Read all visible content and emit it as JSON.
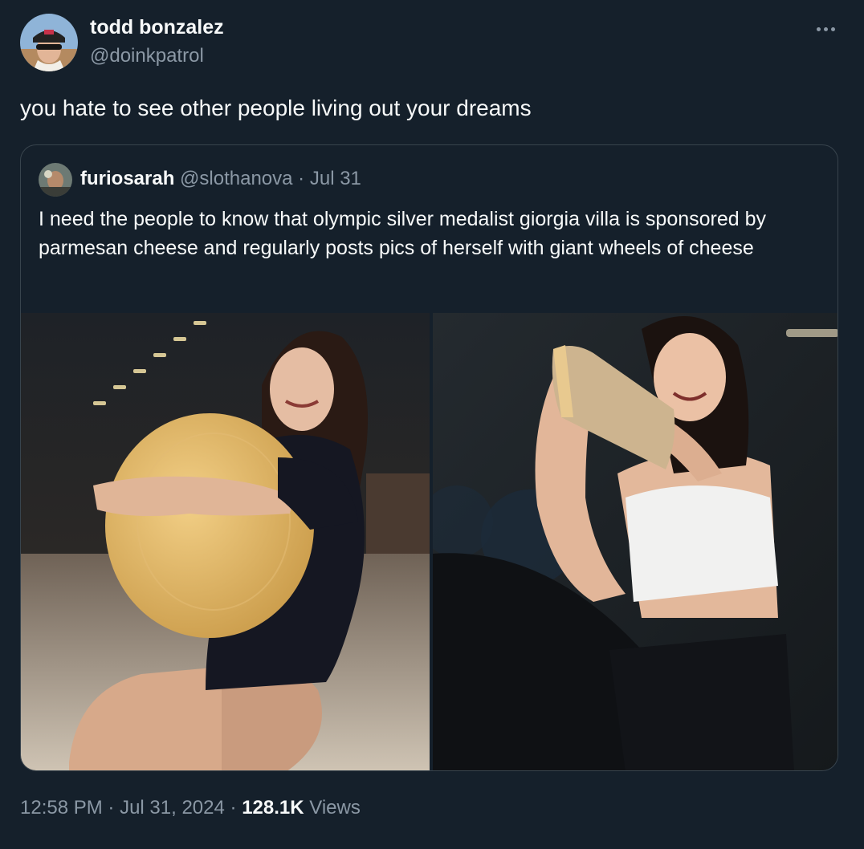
{
  "tweet": {
    "author": {
      "name": "todd bonzalez",
      "handle": "@doinkpatrol"
    },
    "text": "you hate to see other people living out your dreams",
    "more_icon": "more-horizontal-icon"
  },
  "quoted_tweet": {
    "author": {
      "name": "furiosarah",
      "handle": "@slothanova"
    },
    "separator": "·",
    "date": "Jul 31",
    "text": "I need the people to know that olympic silver medalist giorgia villa is sponsored by parmesan cheese and regularly posts pics of herself with giant wheels of cheese",
    "media_count": 2
  },
  "meta": {
    "time": "12:58 PM",
    "sep1": "·",
    "date": "Jul 31, 2024",
    "sep2": "·",
    "views_count": "128.1K",
    "views_label": "Views"
  },
  "colors": {
    "background": "#15202b",
    "text_primary": "#f7f9f9",
    "text_secondary": "#8b98a5",
    "border": "#38444d"
  }
}
